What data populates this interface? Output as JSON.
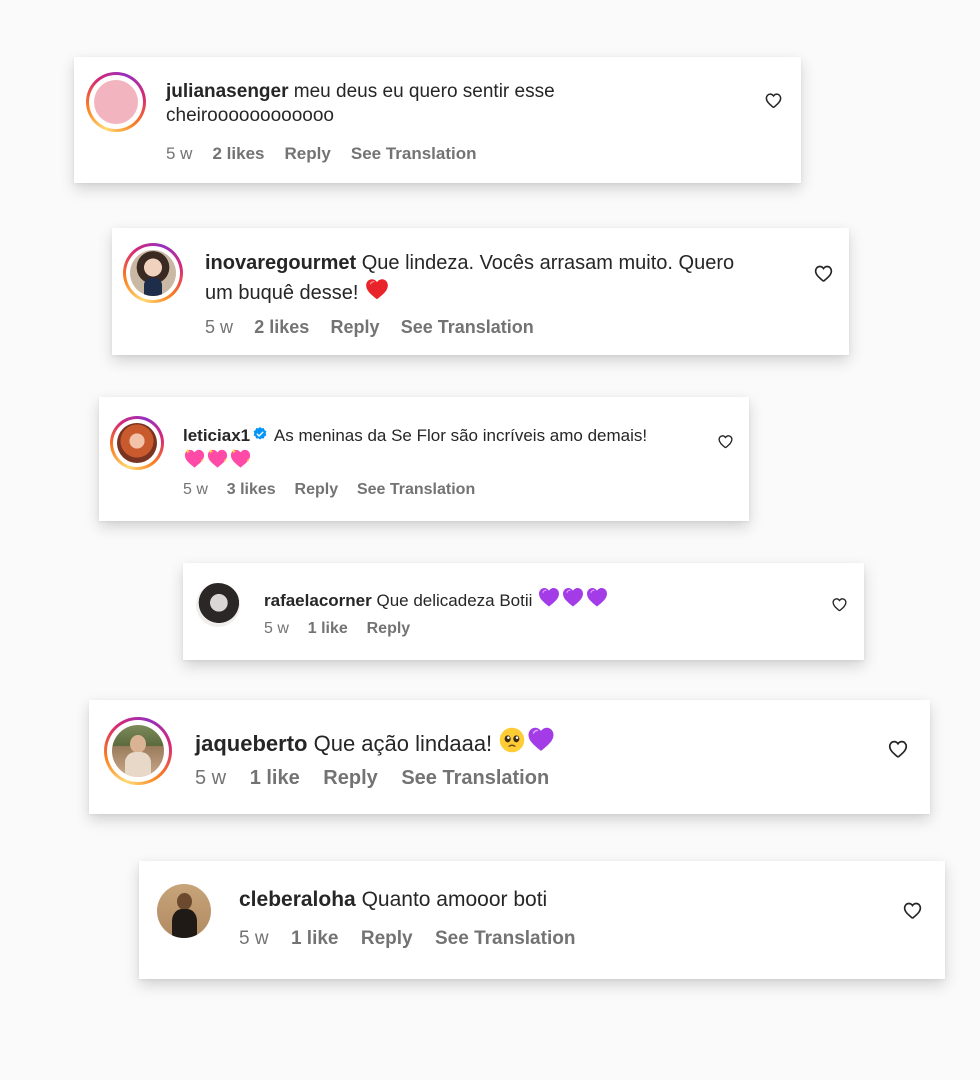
{
  "comments": [
    {
      "username": "julianasenger",
      "text": "meu deus eu quero sentir esse",
      "text2": "cheiroooooooooooo",
      "age": "5 w",
      "likes": "2 likes",
      "reply": "Reply",
      "translate": "See Translation",
      "avatar": "pink-placeholder"
    },
    {
      "username": "inovaregourmet",
      "text": "Que lindeza. Vocês arrasam muito. Quero",
      "text2": "um buquê desse!",
      "emoji": "red-heart",
      "age": "5 w",
      "likes": "2 likes",
      "reply": "Reply",
      "translate": "See Translation",
      "avatar": "woman-dark-hair"
    },
    {
      "username": "leticiax1",
      "verified": true,
      "text": "As meninas da Se Flor são incríveis amo demais!",
      "emoji": "sparkling-heart x3",
      "age": "5 w",
      "likes": "3 likes",
      "reply": "Reply",
      "translate": "See Translation",
      "avatar": "woman-red-hair"
    },
    {
      "username": "rafaelacorner",
      "text": "Que delicadeza Botii",
      "emoji": "purple-heart x3",
      "age": "5 w",
      "likes": "1 like",
      "reply": "Reply",
      "avatar": "woman-grayscale"
    },
    {
      "username": "jaqueberto",
      "text": "Que ação lindaaa!",
      "emoji": "pleading-face, purple-heart",
      "age": "5 w",
      "likes": "1 like",
      "reply": "Reply",
      "translate": "See Translation",
      "avatar": "woman-outdoor"
    },
    {
      "username": "cleberaloha",
      "text": "Quanto amooor boti",
      "age": "5 w",
      "likes": "1 like",
      "reply": "Reply",
      "translate": "See Translation",
      "avatar": "man-mirror-selfie"
    }
  ],
  "colors": {
    "text": "#262626",
    "meta": "#737373",
    "verified": "#0095f6",
    "purple_heart": "#a33ce6",
    "red_heart": "#e8242a",
    "sparkling_heart": "#ff4aa8"
  }
}
